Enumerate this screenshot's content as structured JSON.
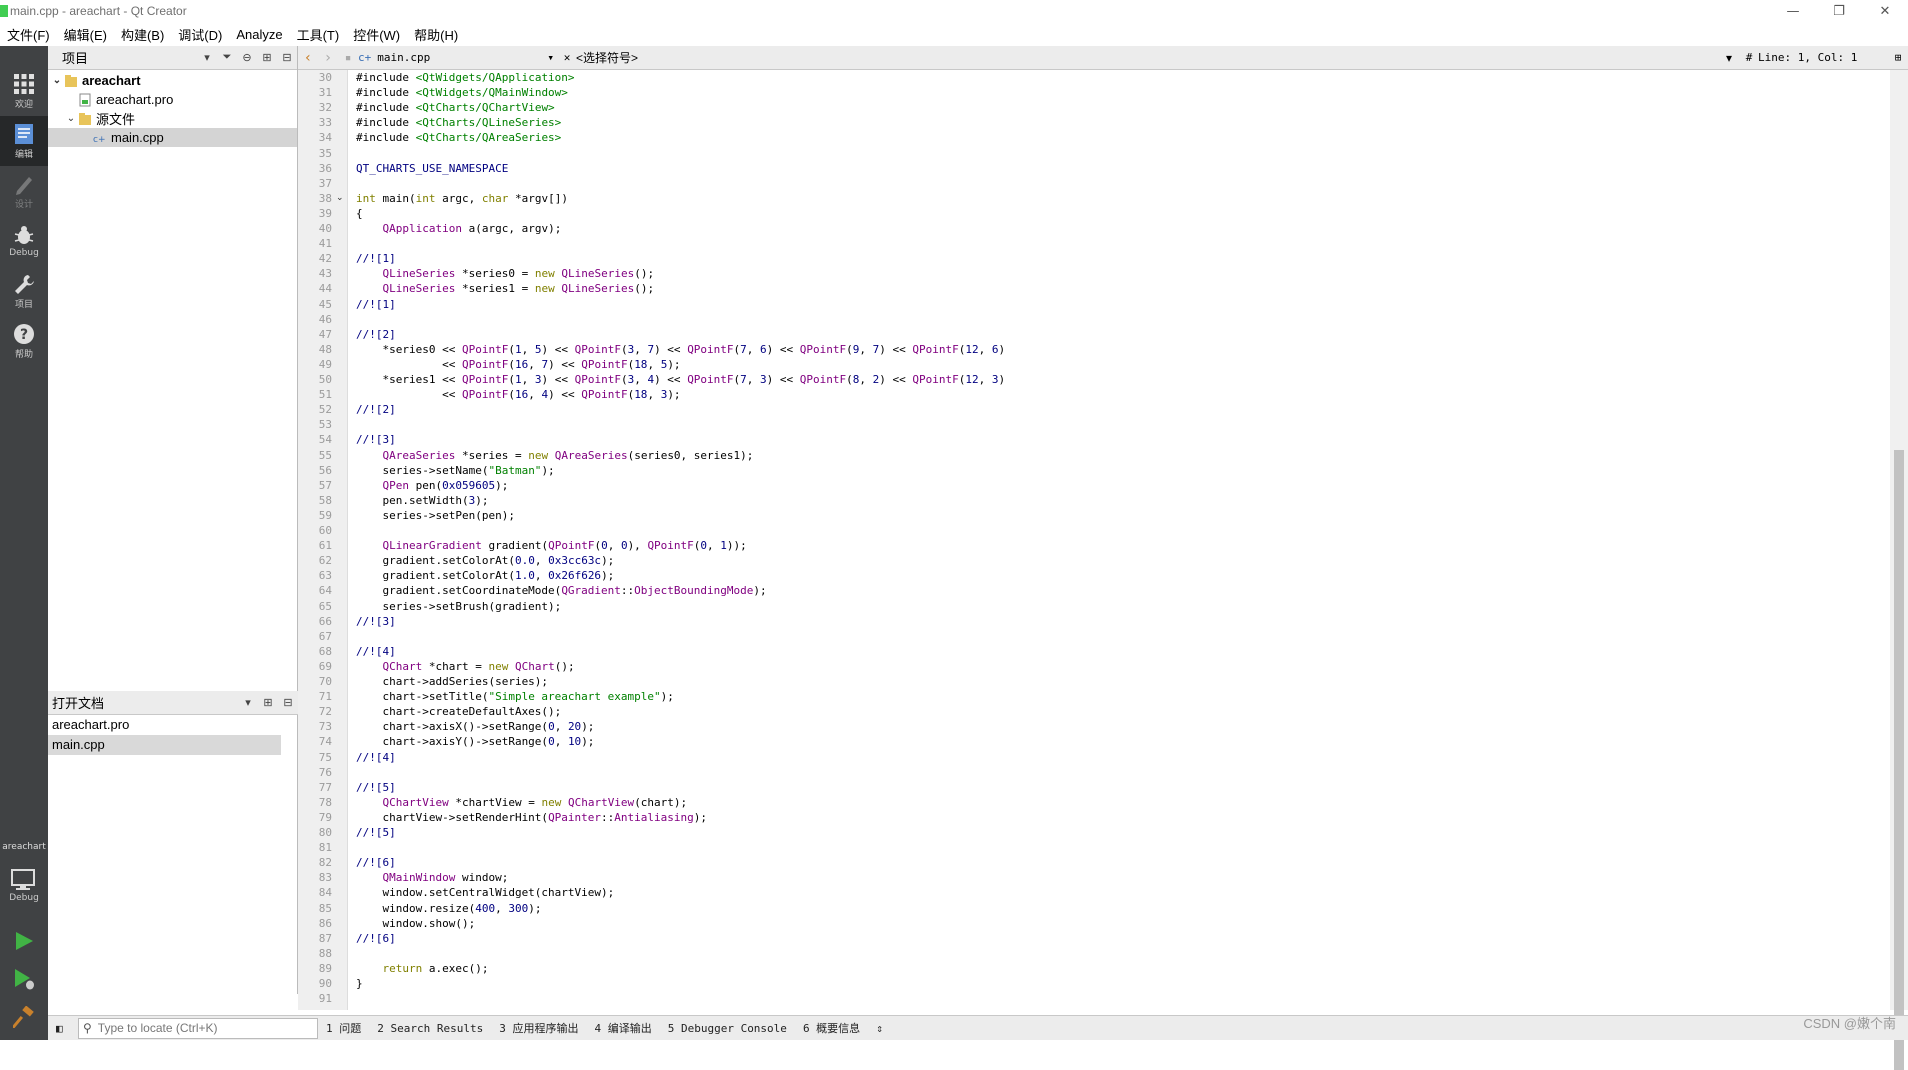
{
  "window": {
    "title": "main.cpp - areachart - Qt Creator",
    "minimize": "—",
    "maximize": "❐",
    "close": "✕"
  },
  "menu": [
    "文件(F)",
    "编辑(E)",
    "构建(B)",
    "调试(D)",
    "Analyze",
    "工具(T)",
    "控件(W)",
    "帮助(H)"
  ],
  "modes": [
    {
      "label": "欢迎",
      "icon": "grid-icon"
    },
    {
      "label": "编辑",
      "icon": "edit-icon"
    },
    {
      "label": "设计",
      "icon": "pen-icon"
    },
    {
      "label": "Debug",
      "icon": "bug-icon"
    },
    {
      "label": "项目",
      "icon": "wrench-icon"
    },
    {
      "label": "帮助",
      "icon": "help-icon"
    }
  ],
  "kit": {
    "project": "areachart",
    "config": "Debug"
  },
  "projects_pane": {
    "title": "项目",
    "tree": {
      "root": "areachart",
      "pro": "areachart.pro",
      "sources": "源文件",
      "main": "main.cpp"
    }
  },
  "open_docs": {
    "title": "打开文档",
    "items": [
      "areachart.pro",
      "main.cpp"
    ]
  },
  "editor": {
    "file": "main.cpp",
    "symbol": "<选择符号>",
    "position": "Line: 1, Col: 1",
    "hash": "#"
  },
  "code": {
    "first_line": 30,
    "lines": [
      "#include <QtWidgets/QApplication>",
      "#include <QtWidgets/QMainWindow>",
      "#include <QtCharts/QChartView>",
      "#include <QtCharts/QLineSeries>",
      "#include <QtCharts/QAreaSeries>",
      "",
      "QT_CHARTS_USE_NAMESPACE",
      "",
      "int main(int argc, char *argv[])",
      "{",
      "    QApplication a(argc, argv);",
      "",
      "//![1]",
      "    QLineSeries *series0 = new QLineSeries();",
      "    QLineSeries *series1 = new QLineSeries();",
      "//![1]",
      "",
      "//![2]",
      "    *series0 << QPointF(1, 5) << QPointF(3, 7) << QPointF(7, 6) << QPointF(9, 7) << QPointF(12, 6)",
      "             << QPointF(16, 7) << QPointF(18, 5);",
      "    *series1 << QPointF(1, 3) << QPointF(3, 4) << QPointF(7, 3) << QPointF(8, 2) << QPointF(12, 3)",
      "             << QPointF(16, 4) << QPointF(18, 3);",
      "//![2]",
      "",
      "//![3]",
      "    QAreaSeries *series = new QAreaSeries(series0, series1);",
      "    series->setName(\"Batman\");",
      "    QPen pen(0x059605);",
      "    pen.setWidth(3);",
      "    series->setPen(pen);",
      "",
      "    QLinearGradient gradient(QPointF(0, 0), QPointF(0, 1));",
      "    gradient.setColorAt(0.0, 0x3cc63c);",
      "    gradient.setColorAt(1.0, 0x26f626);",
      "    gradient.setCoordinateMode(QGradient::ObjectBoundingMode);",
      "    series->setBrush(gradient);",
      "//![3]",
      "",
      "//![4]",
      "    QChart *chart = new QChart();",
      "    chart->addSeries(series);",
      "    chart->setTitle(\"Simple areachart example\");",
      "    chart->createDefaultAxes();",
      "    chart->axisX()->setRange(0, 20);",
      "    chart->axisY()->setRange(0, 10);",
      "//![4]",
      "",
      "//![5]",
      "    QChartView *chartView = new QChartView(chart);",
      "    chartView->setRenderHint(QPainter::Antialiasing);",
      "//![5]",
      "",
      "//![6]",
      "    QMainWindow window;",
      "    window.setCentralWidget(chartView);",
      "    window.resize(400, 300);",
      "    window.show();",
      "//![6]",
      "",
      "    return a.exec();",
      "}",
      ""
    ]
  },
  "status": {
    "locate_placeholder": "Type to locate (Ctrl+K)",
    "tabs": [
      "1 问题",
      "2 Search Results",
      "3 应用程序输出",
      "4 编译输出",
      "5 Debugger Console",
      "6 概要信息"
    ]
  },
  "watermark": "CSDN @嫩个南",
  "colors": {
    "keyword": "#808000",
    "type": "#800080",
    "string": "#008000",
    "number": "#000080",
    "sidebar": "#404244",
    "run": "#41b345"
  }
}
